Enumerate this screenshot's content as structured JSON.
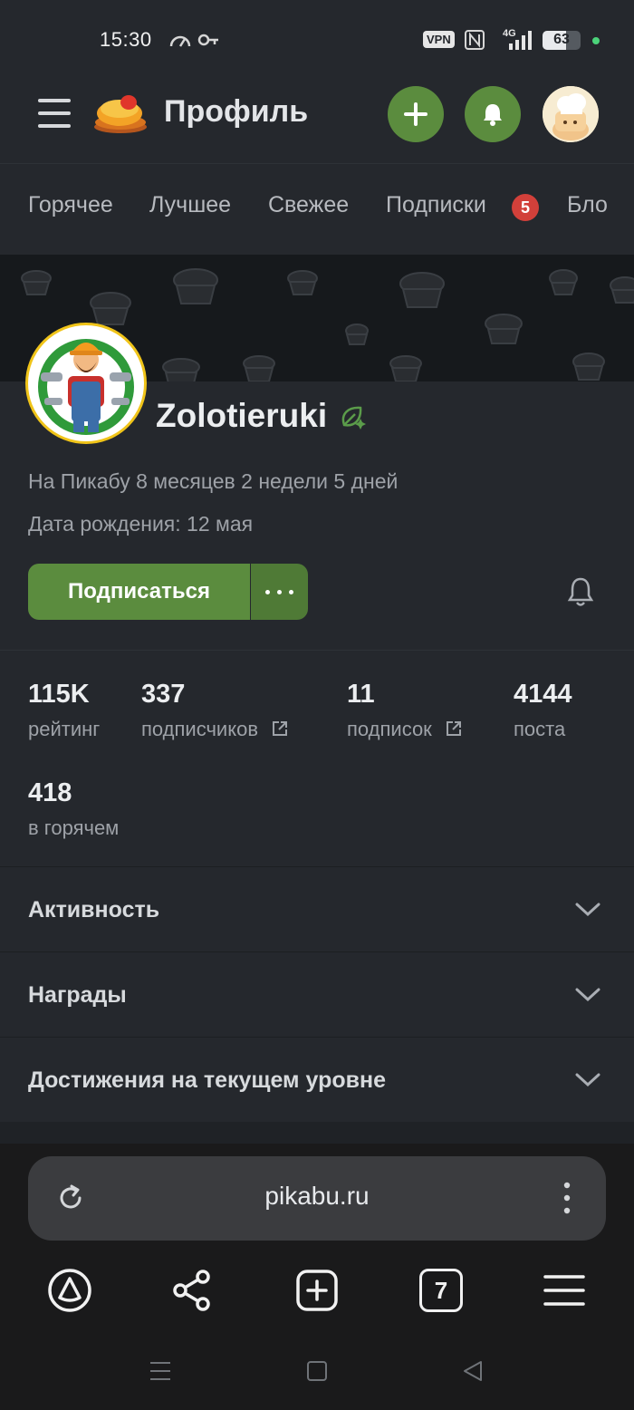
{
  "status_bar": {
    "time": "15:30",
    "vpn": "VPN",
    "network": "4G",
    "battery": "63",
    "battery_level": 0.63,
    "icons": [
      "speedometer-icon",
      "key-icon",
      "nfc-icon",
      "signal-icon",
      "battery-icon"
    ]
  },
  "header": {
    "title": "Профиль",
    "logo_icon": "pikabu-logo",
    "add_icon": "plus-icon",
    "bell_icon": "bell-icon",
    "accent_color": "#5b8c3e"
  },
  "tabs": {
    "items": [
      {
        "label": "Горячее"
      },
      {
        "label": "Лучшее"
      },
      {
        "label": "Свежее"
      },
      {
        "label": "Подписки",
        "badge": "5"
      },
      {
        "label": "Бло"
      }
    ]
  },
  "profile": {
    "username": "Zolotieruki",
    "on_site": "На Пикабу 8 месяцев 2 недели 5 дней",
    "birthday": "Дата рождения: 12 мая",
    "subscribe_label": "Подписаться",
    "more_label": "•••"
  },
  "stats": [
    {
      "value": "115K",
      "label": "рейтинг"
    },
    {
      "value": "337",
      "label": "подписчиков"
    },
    {
      "value": "11",
      "label": "подписок"
    },
    {
      "value": "4144",
      "label": "поста"
    },
    {
      "value": "418",
      "label": "в горячем"
    }
  ],
  "sections": [
    {
      "label": "Активность"
    },
    {
      "label": "Награды"
    },
    {
      "label": "Достижения на текущем уровне"
    }
  ],
  "browser": {
    "url": "pikabu.ru",
    "tabs_count": "7"
  }
}
